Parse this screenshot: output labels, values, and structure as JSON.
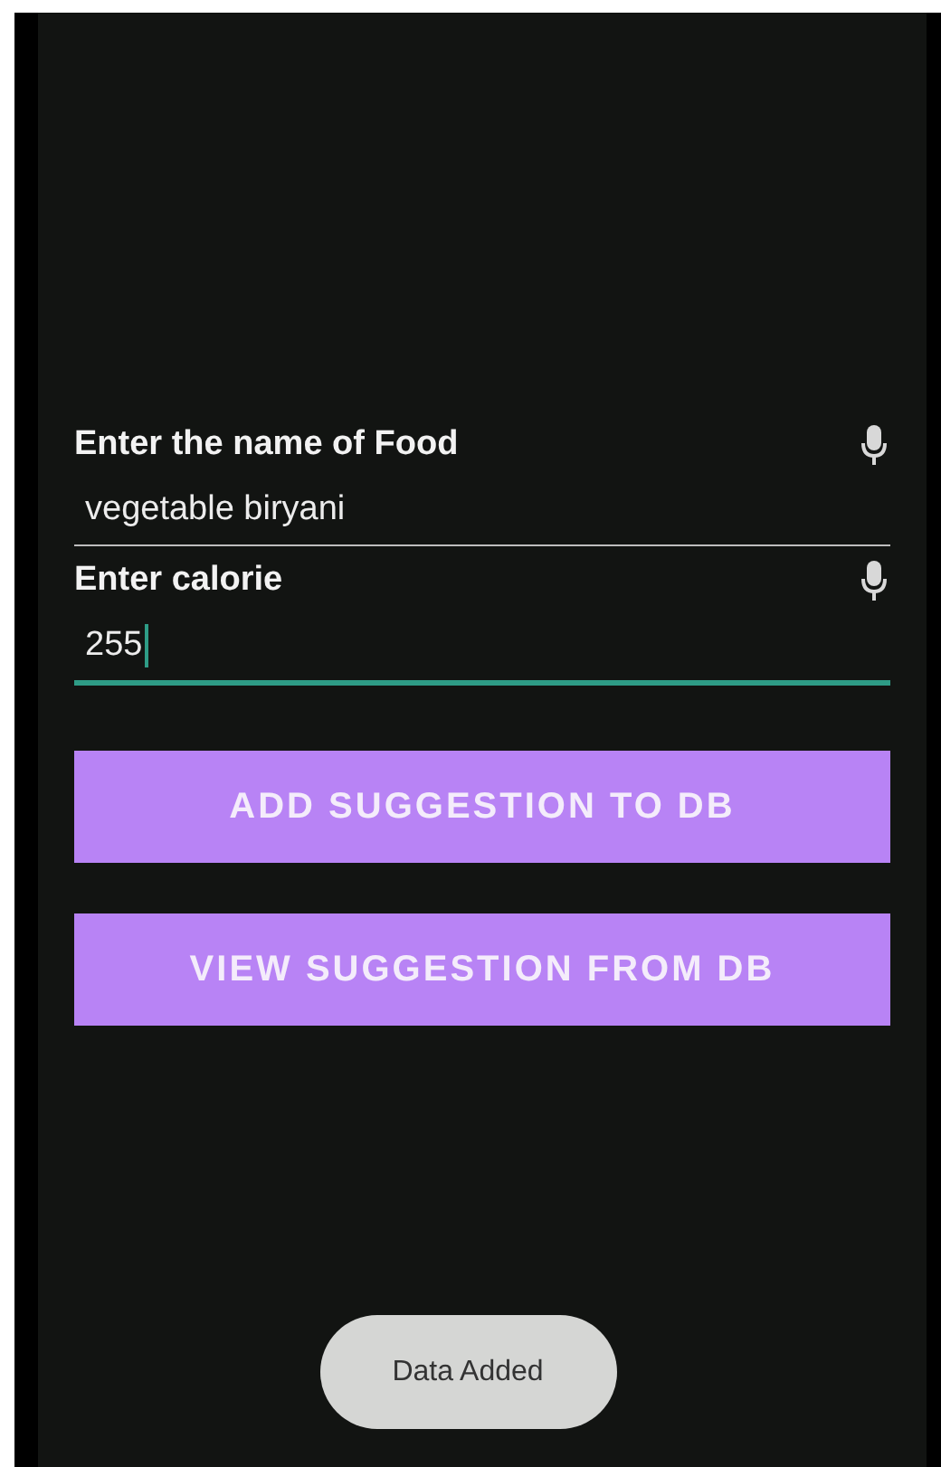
{
  "fields": [
    {
      "label": "Enter the name of Food",
      "value": "vegetable biryani",
      "focused": false
    },
    {
      "label": "Enter calorie",
      "value": "255",
      "focused": true
    }
  ],
  "buttons": [
    "ADD SUGGESTION TO DB",
    "VIEW SUGGESTION FROM DB"
  ],
  "toast": "Data Added"
}
